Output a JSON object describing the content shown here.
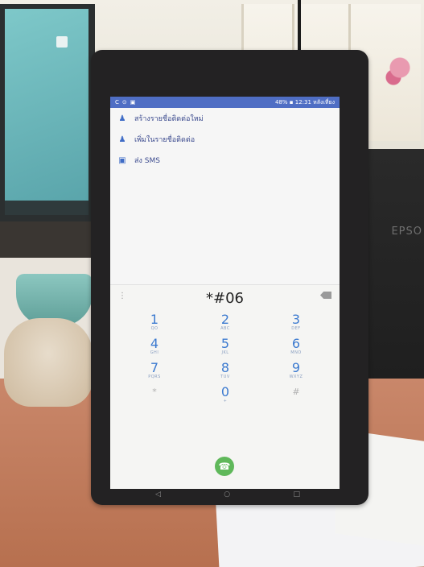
{
  "status_bar": {
    "left_icons": [
      "C",
      "⊙",
      "▣"
    ],
    "right_text": "48% ▪ 12:31 หลังเที่ยง"
  },
  "menu": [
    {
      "icon": "person-add-icon",
      "label": "สร้างรายชื่อติดต่อใหม่"
    },
    {
      "icon": "person-add-icon",
      "label": "เพิ่มในรายชื่อติดต่อ"
    },
    {
      "icon": "message-icon",
      "label": "ส่ง SMS"
    }
  ],
  "dialer": {
    "number": "*#06",
    "keys": [
      {
        "digit": "1",
        "letters": "QO"
      },
      {
        "digit": "2",
        "letters": "ABC"
      },
      {
        "digit": "3",
        "letters": "DEF"
      },
      {
        "digit": "4",
        "letters": "GHI"
      },
      {
        "digit": "5",
        "letters": "JKL"
      },
      {
        "digit": "6",
        "letters": "MNO"
      },
      {
        "digit": "7",
        "letters": "PQRS"
      },
      {
        "digit": "8",
        "letters": "TUV"
      },
      {
        "digit": "9",
        "letters": "WXYZ"
      },
      {
        "digit": "*",
        "letters": ""
      },
      {
        "digit": "0",
        "letters": "+"
      },
      {
        "digit": "#",
        "letters": ""
      }
    ]
  },
  "nav": {
    "back": "◁",
    "home": "○",
    "recents": "□"
  },
  "background": {
    "printer_label": "EPSO"
  },
  "colors": {
    "status_bar": "#4f6ec4",
    "accent": "#3d7bd0",
    "call": "#5fb85a"
  }
}
